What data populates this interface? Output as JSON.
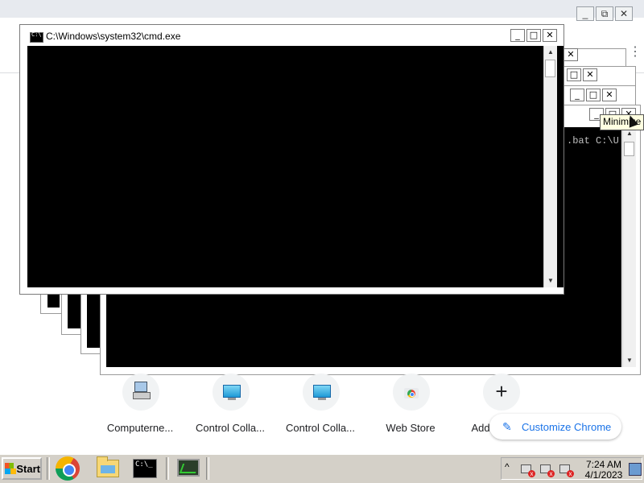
{
  "cmd_window": {
    "title": "C:\\Windows\\system32\\cmd.exe",
    "minimize_glyph": "_",
    "maximize_glyph": "□",
    "close_glyph": "✕"
  },
  "background_cmd": {
    "visible_text": ".bat C:\\U"
  },
  "tooltip": {
    "text": "Minimize"
  },
  "chrome": {
    "shortcuts": [
      {
        "label": "Computerne...",
        "icon": "computer-network-icon"
      },
      {
        "label": "Control Colla...",
        "icon": "monitor-icon"
      },
      {
        "label": "Control Colla...",
        "icon": "monitor-icon"
      },
      {
        "label": "Web Store",
        "icon": "chrome-web-store-icon"
      },
      {
        "label": "Add shortcut",
        "icon": "plus-icon"
      }
    ],
    "customize_label": "Customize Chrome",
    "accent": "#1a73e8"
  },
  "taskbar": {
    "start_label": "Start",
    "apps": [
      "chrome-icon",
      "folder-icon",
      "cmd-icon",
      "task-manager-icon"
    ],
    "clock_time": "7:24 AM",
    "clock_date": "4/1/2023"
  }
}
